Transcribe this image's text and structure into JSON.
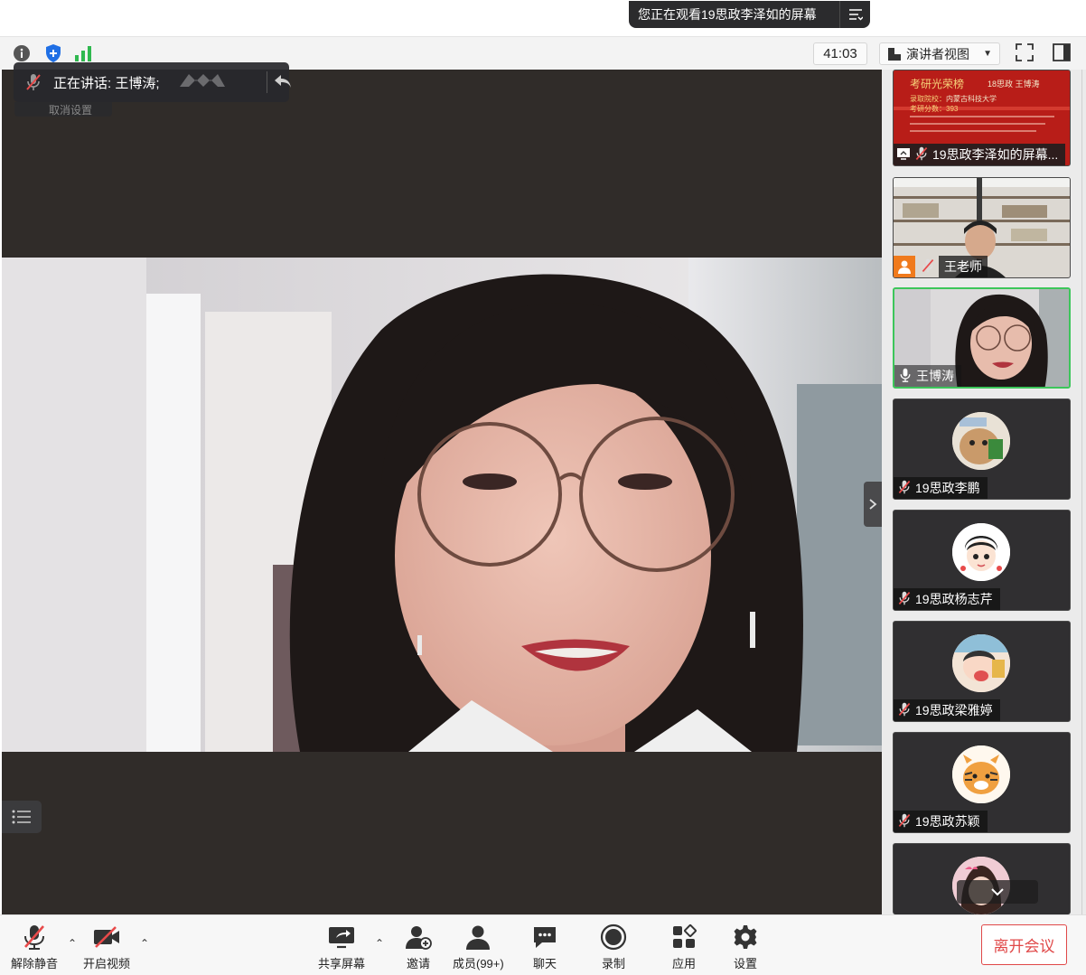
{
  "banner": {
    "text": "您正在观看19思政李泽如的屏幕"
  },
  "toolbar": {
    "timer": "41:03",
    "view_label": "演讲者视图"
  },
  "speaker": {
    "label": "正在讲话: 王博涛;",
    "hidden_text": "取消设置"
  },
  "participants": [
    {
      "name": "19思政李泽如的屏幕...",
      "kind": "screen-share",
      "muted": true
    },
    {
      "name": "王老师",
      "kind": "video",
      "muted": true
    },
    {
      "name": "王博涛",
      "kind": "video",
      "muted": false,
      "active": true
    },
    {
      "name": "19思政李鹏",
      "kind": "avatar",
      "muted": true
    },
    {
      "name": "19思政杨志芹",
      "kind": "avatar",
      "muted": true
    },
    {
      "name": "19思政梁雅婷",
      "kind": "avatar",
      "muted": true
    },
    {
      "name": "19思政苏颖",
      "kind": "avatar",
      "muted": true
    },
    {
      "name": "",
      "kind": "avatar",
      "muted": true
    }
  ],
  "screen_preview": {
    "title": "考研光荣榜",
    "subtitle": "18思政 王博涛",
    "line1_label": "录取院校：",
    "line1_value": "内蒙古科技大学",
    "line2": "考研分数：393"
  },
  "bottom_bar": {
    "unmute": "解除静音",
    "start_video": "开启视频",
    "share": "共享屏幕",
    "invite": "邀请",
    "members": "成员(99+)",
    "chat": "聊天",
    "record": "录制",
    "apps": "应用",
    "settings": "设置",
    "leave": "离开会议"
  },
  "colors": {
    "stage_bg": "#302c29",
    "active_border": "#3cc65a",
    "leave_red": "#e04848",
    "mic_muted_red": "#e84a4a"
  }
}
